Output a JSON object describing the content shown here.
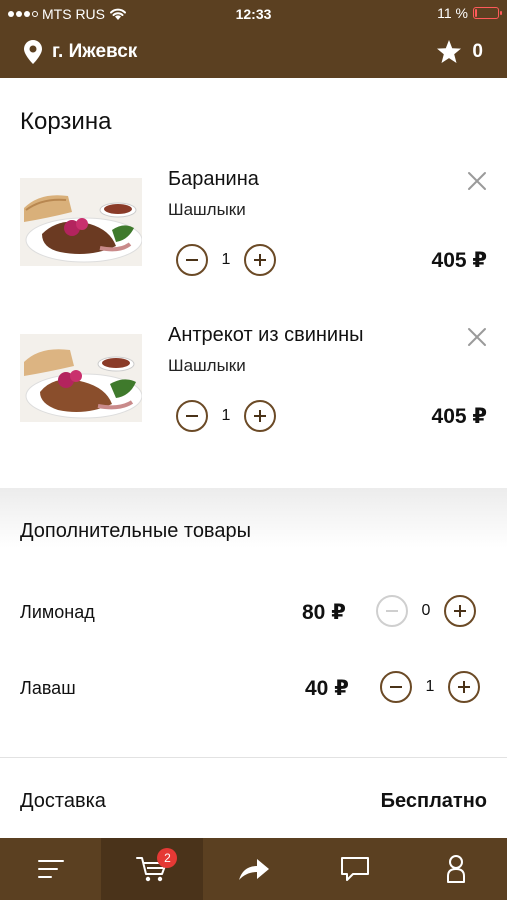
{
  "status_bar": {
    "carrier": "MTS RUS",
    "time": "12:33",
    "battery_text": "11 %",
    "battery_level": 0.11
  },
  "header": {
    "city": "г. Ижевск",
    "favorites_count": "0"
  },
  "page": {
    "title": "Корзина"
  },
  "cart_items": [
    {
      "name": "Баранина",
      "category": "Шашлыки",
      "quantity": "1",
      "price": "405 ₽"
    },
    {
      "name": "Антрекот из свинины",
      "category": "Шашлыки",
      "quantity": "1",
      "price": "405 ₽"
    }
  ],
  "extras": {
    "title": "Дополнительные товары",
    "items": [
      {
        "name": "Лимонад",
        "price": "80 ₽",
        "quantity": "0"
      },
      {
        "name": "Лаваш",
        "price": "40 ₽",
        "quantity": "1"
      }
    ]
  },
  "delivery": {
    "label": "Доставка",
    "value": "Бесплатно"
  },
  "tabbar": {
    "tabs": [
      "menu-icon",
      "cart-icon",
      "share-icon",
      "chat-icon",
      "profile-icon"
    ],
    "active": "cart-icon",
    "cart_badge": "2"
  },
  "colors": {
    "brand": "#5b4021",
    "accent_border": "#6b4a26",
    "badge": "#e53935"
  }
}
